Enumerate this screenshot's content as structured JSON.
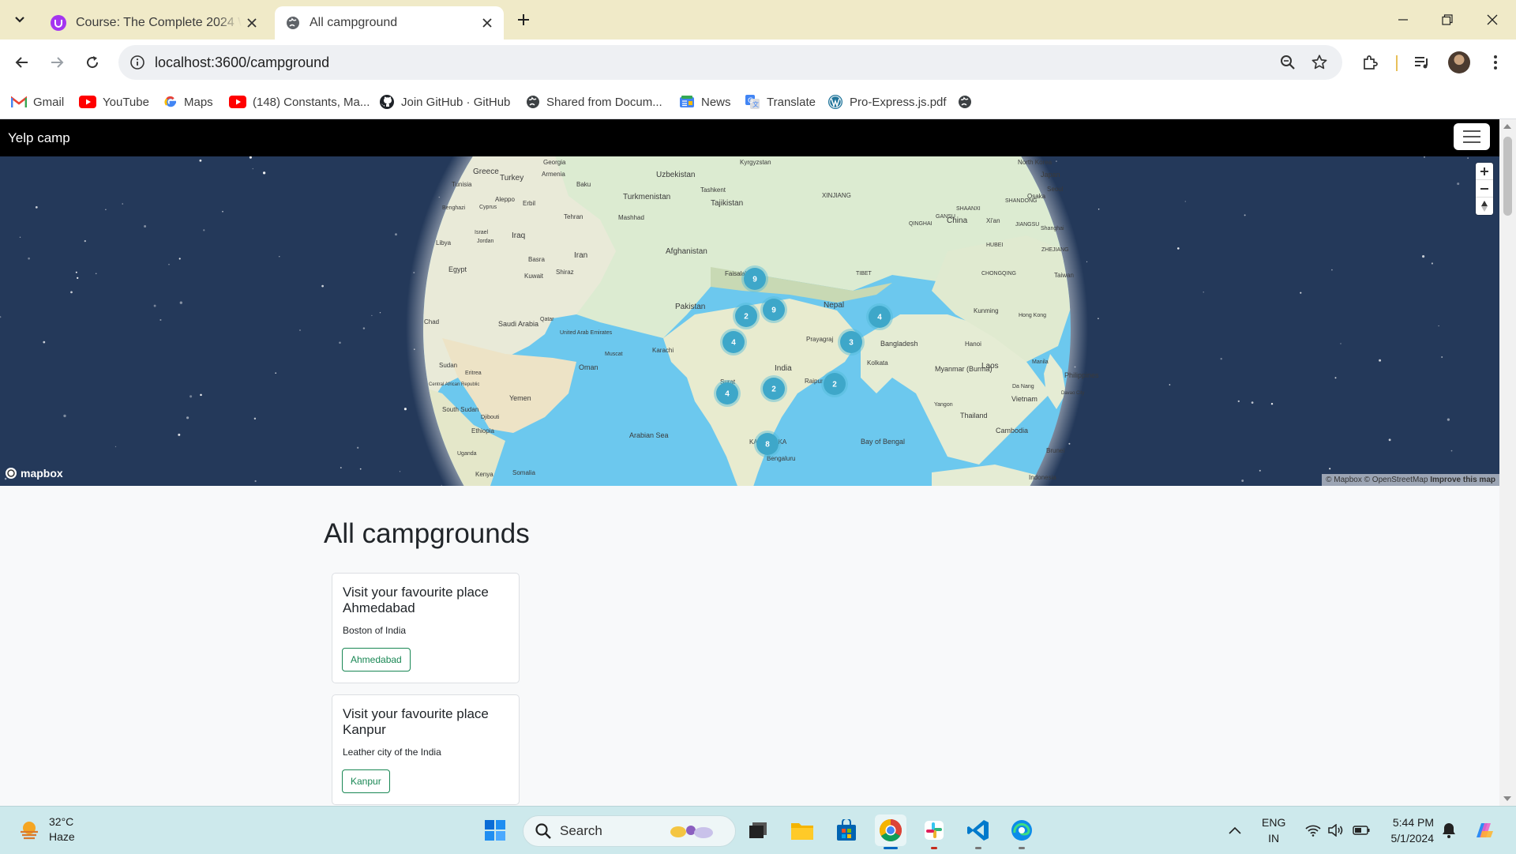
{
  "browser": {
    "tabs": [
      {
        "title": "Course: The Complete 2024 Web",
        "active": false
      },
      {
        "title": "All campground",
        "active": true
      }
    ],
    "url": "localhost:3600/campground",
    "bookmarks": [
      {
        "label": "Gmail",
        "icon": "gmail-icon"
      },
      {
        "label": "YouTube",
        "icon": "youtube-icon"
      },
      {
        "label": "Maps",
        "icon": "google-icon"
      },
      {
        "label": "(148) Constants, Ma...",
        "icon": "youtube-icon"
      },
      {
        "label": "Join GitHub · GitHub",
        "icon": "github-icon"
      },
      {
        "label": "Shared from Docum...",
        "icon": "globe-icon"
      },
      {
        "label": "News",
        "icon": "news-icon"
      },
      {
        "label": "Translate",
        "icon": "translate-icon"
      },
      {
        "label": "Pro-Express.js.pdf",
        "icon": "wordpress-icon"
      },
      {
        "label": "",
        "icon": "globe-icon"
      }
    ]
  },
  "navbar": {
    "brand": "Yelp camp"
  },
  "map": {
    "logo_text": "mapbox",
    "attribution": {
      "mapbox": "© Mapbox",
      "osm": "© OpenStreetMap",
      "improve": "Improve this map"
    },
    "labels": [
      "Georgia",
      "Kyrgyzstan",
      "North Korea",
      "Greece",
      "Turkey",
      "Armenia",
      "Baku",
      "Uzbekistan",
      "Tashkent",
      "Japan",
      "Tunisia",
      "Benghazi",
      "Cyprus",
      "Aleppo",
      "Erbil",
      "Turkmenistan",
      "Tajikistan",
      "XINJIANG",
      "Seoul",
      "Tehran",
      "Mashhad",
      "Osaka",
      "Israel",
      "Iraq",
      "GANSU",
      "SHAANXI",
      "SHANDONG",
      "Jordan",
      "China",
      "Xi'an",
      "Libya",
      "Iran",
      "Afghanistan",
      "QINGHAI",
      "JIANGSU",
      "Shanghai",
      "Egypt",
      "Basra",
      "Kuwait",
      "Shiraz",
      "Faisalabad",
      "TIBET",
      "HUBEI",
      "ZHEJIANG",
      "Pakistan",
      "Nepal",
      "CHONGQING",
      "Taiwan",
      "Chad",
      "Saudi Arabia",
      "Qatar",
      "United Arab Emirates",
      "Karachi",
      "Prayagraj",
      "Kunming",
      "Hong Kong",
      "Muscat",
      "Bangladesh",
      "Hanoi",
      "Oman",
      "India",
      "Kolkata",
      "Myanmar (Burma)",
      "Laos",
      "Manila",
      "Sudan",
      "Eritrea",
      "Surat",
      "Raipur",
      "Philippines",
      "Central African Republic",
      "Yemen",
      "Yangon",
      "Da Nang",
      "Davao City",
      "South Sudan",
      "Djibouti",
      "Vietnam",
      "Thailand",
      "Ethiopia",
      "Arabian Sea",
      "Bay of Bengal",
      "Cambodia",
      "KARNATAKA",
      "Bengaluru",
      "Uganda",
      "Brunei",
      "Kenya",
      "Somalia",
      "Indonesia"
    ],
    "clusters": [
      "9",
      "9",
      "2",
      "4",
      "4",
      "3",
      "4",
      "2",
      "2",
      "8"
    ]
  },
  "main": {
    "heading": "All campgrounds",
    "campgrounds": [
      {
        "title": "Visit your favourite place Ahmedabad",
        "description": "Boston of India",
        "button": "Ahmedabad"
      },
      {
        "title": "Visit your favourite place Kanpur",
        "description": "Leather city of the India",
        "button": "Kanpur"
      }
    ]
  },
  "taskbar": {
    "weather": {
      "temp": "32°C",
      "condition": "Haze"
    },
    "search_label": "Search",
    "language": {
      "lang": "ENG",
      "region": "IN"
    },
    "time": "5:44 PM",
    "date": "5/1/2024"
  },
  "colors": {
    "accent_green": "#198754",
    "navbar": "#000000",
    "taskbar": "#cde9ec",
    "tabstrip": "#f0eac8"
  }
}
